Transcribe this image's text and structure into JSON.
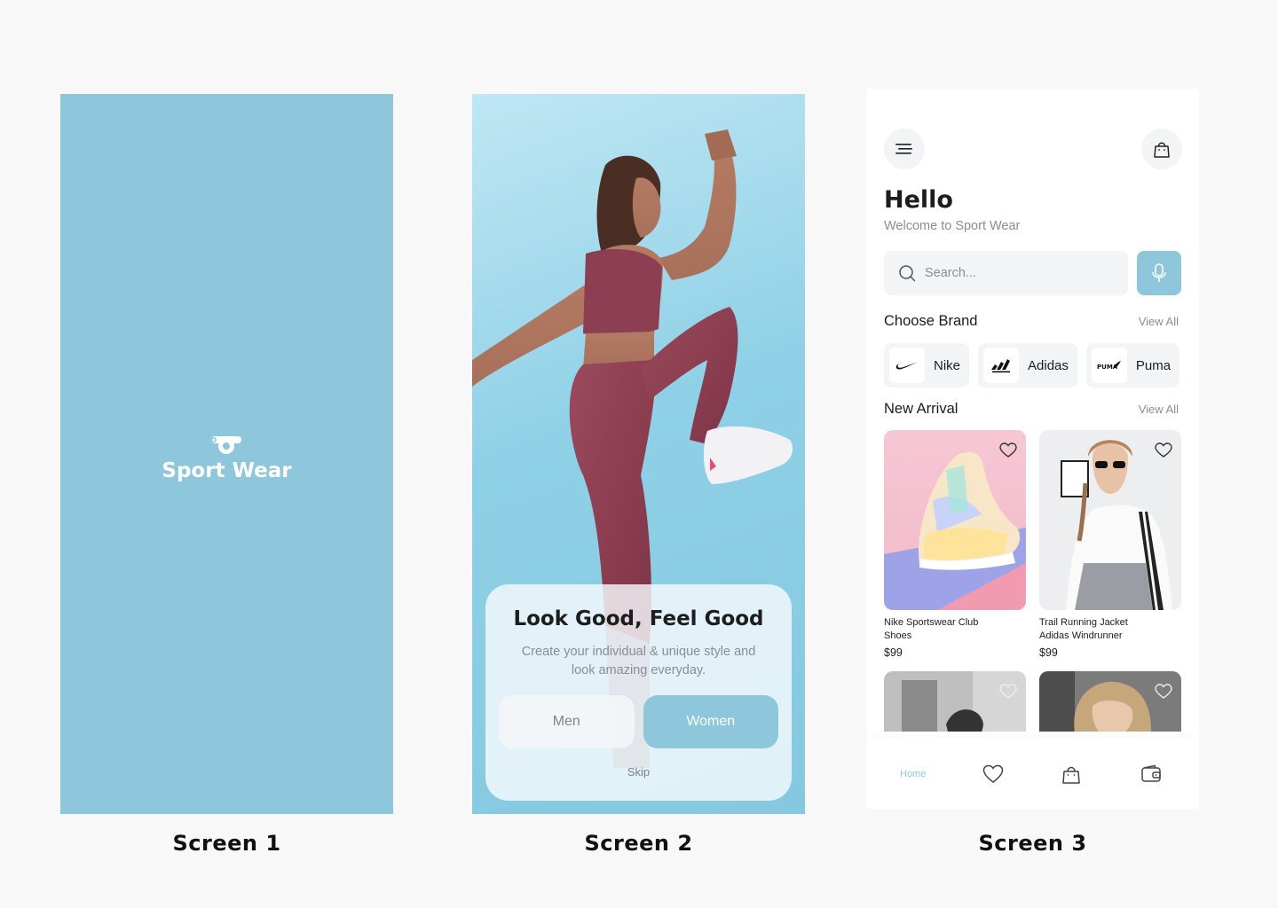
{
  "captions": [
    "Screen 1",
    "Screen 2",
    "Screen 3"
  ],
  "screen1": {
    "brand_name": "Sport Wear",
    "logo_icon": "whistle-icon",
    "background": "#8ec7dc"
  },
  "screen2": {
    "title": "Look Good, Feel Good",
    "subtitle": "Create your individual & unique style and look amazing everyday.",
    "buttons": {
      "men": "Men",
      "women": "Women"
    },
    "skip": "Skip",
    "accent": "#8ec7dc"
  },
  "screen3": {
    "header": {
      "menu_icon": "menu-icon",
      "bag_icon": "shopping-bag-icon"
    },
    "greeting": "Hello",
    "welcome": "Welcome to Sport Wear",
    "search": {
      "placeholder": "Search...",
      "mic_icon": "microphone-icon"
    },
    "choose_brand": {
      "title": "Choose Brand",
      "view_all": "View All",
      "brands": [
        {
          "name": "Nike",
          "icon": "nike-logo"
        },
        {
          "name": "Adidas",
          "icon": "adidas-logo"
        },
        {
          "name": "Puma",
          "icon": "puma-logo"
        }
      ]
    },
    "new_arrival": {
      "title": "New Arrival",
      "view_all": "View All",
      "products": [
        {
          "name": "Nike Sportswear Club Shoes",
          "price": "$99"
        },
        {
          "name": "Trail Running Jacket Adidas Windrunner",
          "price": "$99"
        }
      ]
    },
    "tabbar": {
      "home": "Home",
      "icons": [
        "heart-icon",
        "shopping-bag-icon",
        "wallet-icon"
      ]
    },
    "accent": "#8ec7dc"
  }
}
